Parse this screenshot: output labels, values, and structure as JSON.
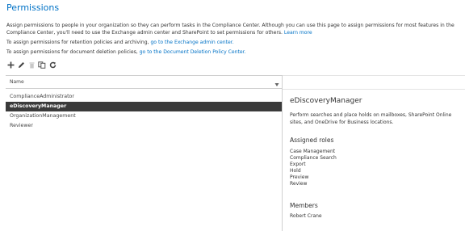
{
  "page": {
    "title": "Permissions",
    "description": "Assign permissions to people in your organization so they can perform tasks in the Compliance Center. Although you can use this page to assign permissions for most features in the Compliance Center, you'll need to use the Exchange admin center and SharePoint to set permissions for others.",
    "learn_more": "Learn more",
    "retention_text": "To assign permissions for retention policies and archiving,",
    "retention_link": "go to the Exchange admin center.",
    "deletion_text": "To assign permissions for document deletion policies,",
    "deletion_link": "go to the Document Deletion Policy Center."
  },
  "toolbar": {
    "add_icon": "plus-icon",
    "edit_icon": "pencil-icon",
    "delete_icon": "trash-icon",
    "copy_icon": "copy-icon",
    "refresh_icon": "refresh-icon"
  },
  "list": {
    "column_header": "Name",
    "rows": [
      {
        "name": "ComplianceAdministrator",
        "selected": false
      },
      {
        "name": "eDiscoveryManager",
        "selected": true
      },
      {
        "name": "OrganizationManagement",
        "selected": false
      },
      {
        "name": "Reviewer",
        "selected": false
      }
    ]
  },
  "detail": {
    "title": "eDiscoveryManager",
    "description": "Perform searches and place holds on mailboxes, SharePoint Online sites, and OneDrive for Business locations.",
    "roles_heading": "Assigned roles",
    "roles": [
      "Case Management",
      "Compliance Search",
      "Export",
      "Hold",
      "Preview",
      "Review"
    ],
    "members_heading": "Members",
    "members": [
      "Robert Crane"
    ]
  },
  "colors": {
    "accent": "#0072c6",
    "selected_row_bg": "#3a3a3a",
    "selected_row_text": "#ffffff"
  }
}
